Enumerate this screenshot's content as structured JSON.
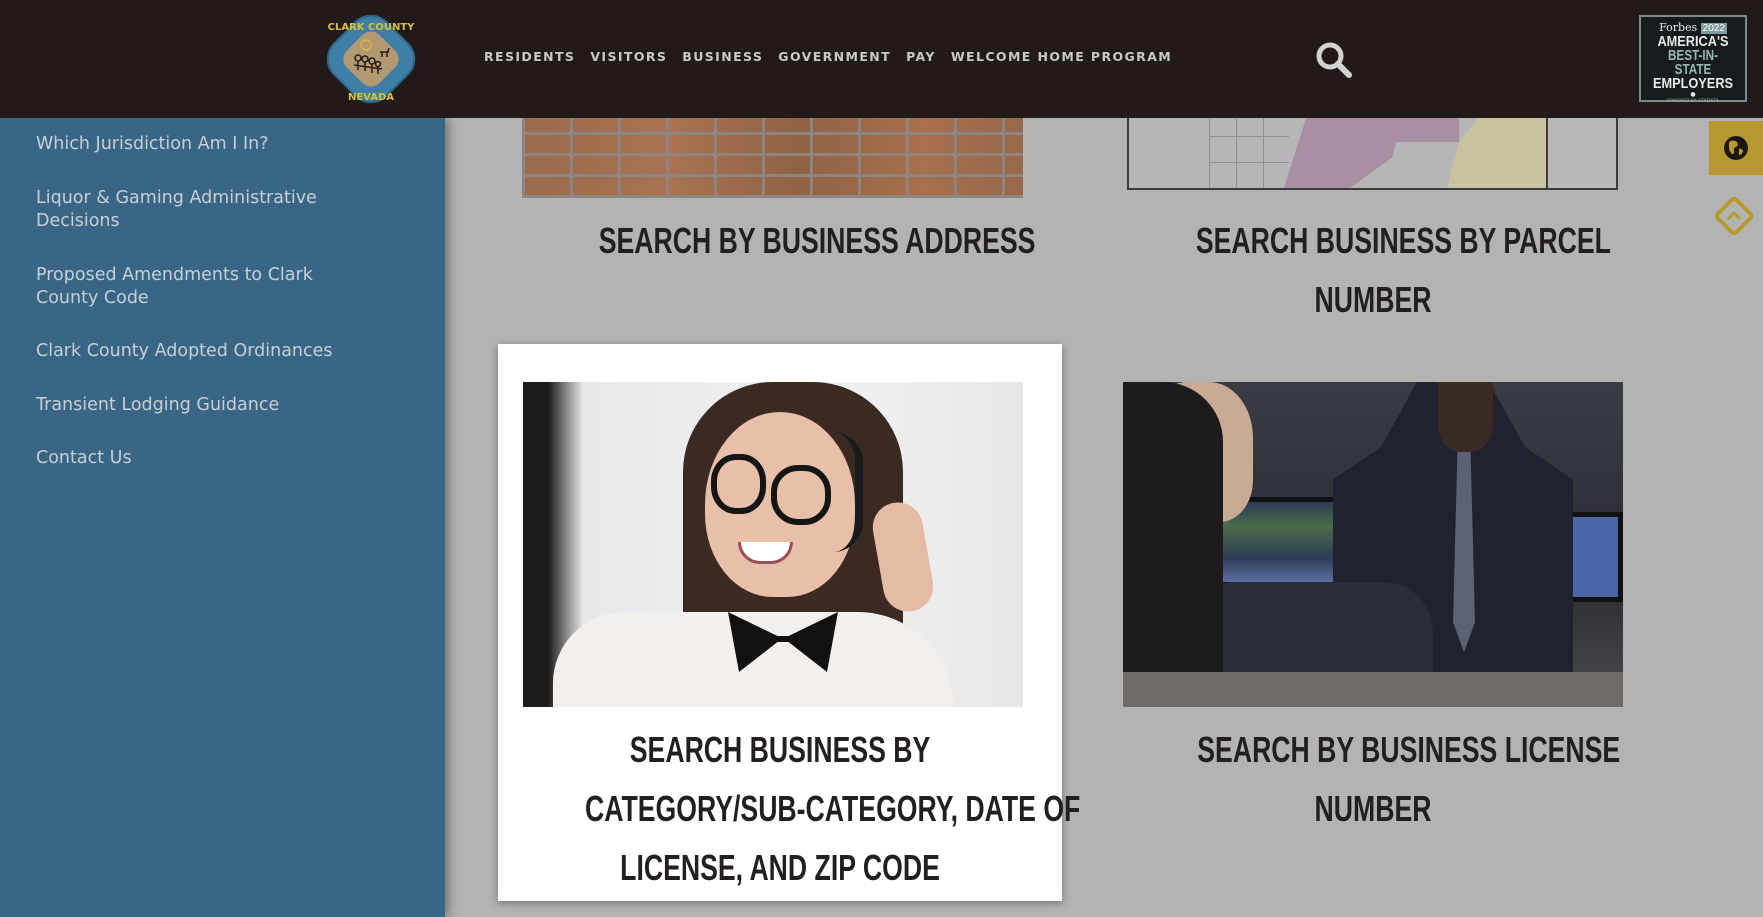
{
  "header": {
    "logo_alt": "Clark County Nevada",
    "logo_text_top": "CLARK COUNTY",
    "logo_text_bottom": "NEVADA",
    "nav": [
      "RESIDENTS",
      "VISITORS",
      "BUSINESS",
      "GOVERNMENT",
      "PAY",
      "WELCOME HOME PROGRAM"
    ],
    "search_icon": "search-icon",
    "badge": {
      "brand": "Forbes",
      "year": "2022",
      "line1": "AMERICA'S",
      "line2": "BEST-IN-STATE",
      "line3": "EMPLOYERS",
      "powered": "POWERED BY STATISTA"
    }
  },
  "sidebar": {
    "items": [
      {
        "label_lines": [
          "Which Jurisdiction Am I In?"
        ]
      },
      {
        "label_lines": [
          "Liquor & Gaming Administrative",
          "Decisions"
        ]
      },
      {
        "label_lines": [
          "Proposed Amendments to Clark",
          "County Code"
        ]
      },
      {
        "label_lines": [
          "Clark County Adopted Ordinances"
        ]
      },
      {
        "label_lines": [
          "Transient Lodging Guidance"
        ]
      },
      {
        "label_lines": [
          "Contact Us"
        ]
      }
    ]
  },
  "tiles": {
    "address": {
      "lines": [
        "SEARCH BY BUSINESS ADDRESS"
      ],
      "image": "brick-wall"
    },
    "parcel": {
      "lines": [
        "SEARCH BUSINESS BY PARCEL",
        "NUMBER"
      ],
      "image": "parcel-map"
    },
    "category": {
      "lines": [
        "SEARCH BUSINESS BY",
        "CATEGORY/SUB-CATEGORY, DATE OF",
        "LICENSE, AND ZIP CODE"
      ],
      "image": "woman-with-headset"
    },
    "license": {
      "lines": [
        "SEARCH BY BUSINESS LICENSE",
        "NUMBER"
      ],
      "image": "business-meeting"
    }
  },
  "floating": {
    "globe_icon": "globe-icon",
    "back_to_top_icon": "chevron-up-diamond-icon"
  },
  "colors": {
    "header_bg": "#211a19",
    "sidebar_bg": "#3a6686",
    "page_bg": "#b3b3b3",
    "accent_gold": "#b8992f",
    "title_text": "#231f20"
  }
}
